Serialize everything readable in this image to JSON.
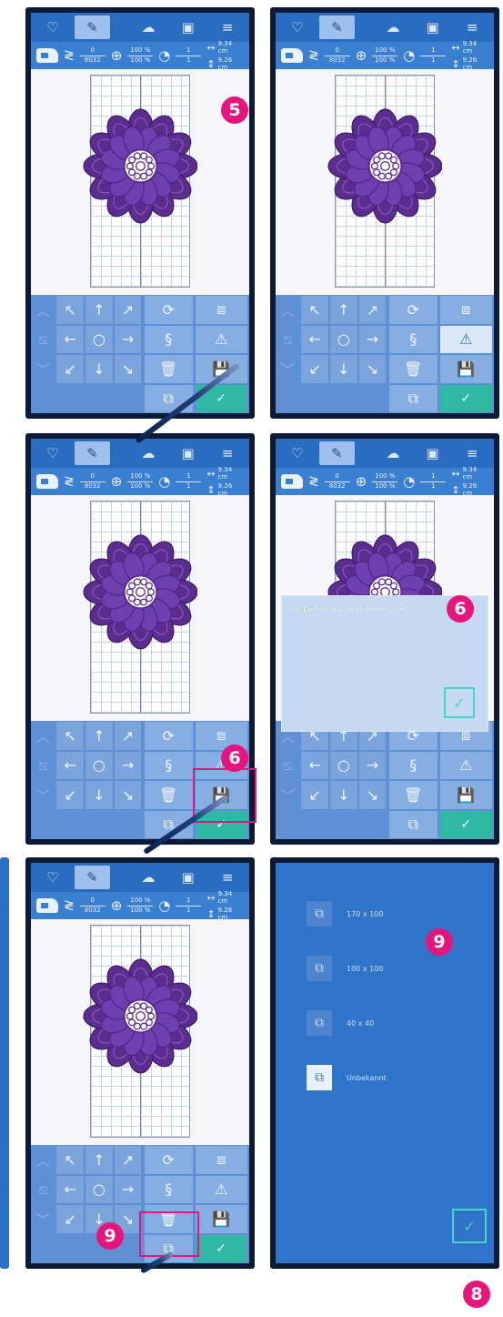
{
  "topbar": {
    "icons": [
      "design-icon",
      "edit-icon",
      "cloud-icon",
      "window-icon",
      "menu-icon"
    ],
    "glyphs": [
      "♡",
      "✎",
      "☁",
      "▣",
      "≡"
    ]
  },
  "info": {
    "stitch_top": "0",
    "stitch_bottom": "8032",
    "zoom_top": "100 %",
    "zoom_bottom": "100 %",
    "color_top": "1",
    "color_bottom": "1",
    "width": "9.34 cm",
    "height": "9.26 cm"
  },
  "controls": {
    "arrows": [
      "↖",
      "↑",
      "↗",
      "←",
      "○",
      "→",
      "↙",
      "↓",
      "↘"
    ],
    "rotate": "⟳",
    "needle": "§",
    "delete": "🗑",
    "hoop": "⧉",
    "resize": "⧈",
    "mirror": "⚠",
    "save": "💾",
    "ok": "✓"
  },
  "badges": {
    "step5": "5",
    "step6a": "6",
    "step6b": "6",
    "step9a": "9",
    "step9b": "9",
    "step8": "8"
  },
  "dialog": {
    "message": "Ihr Design wurde abgespeichert.",
    "ok": "✓"
  },
  "hoop_list": {
    "items": [
      {
        "label": "170 x 100",
        "icon": "⧉"
      },
      {
        "label": "100 x 100",
        "icon": "⧉"
      },
      {
        "label": "40 x 40",
        "icon": "⧉"
      },
      {
        "label": "Unbekannt",
        "icon": "⧉"
      }
    ],
    "ok": "✓"
  },
  "colors": {
    "screen_blue": "#2b70c4",
    "flower_purple": "#6b3aa0",
    "badge_pink": "#e5157d",
    "ok_teal": "#30b8a5"
  }
}
